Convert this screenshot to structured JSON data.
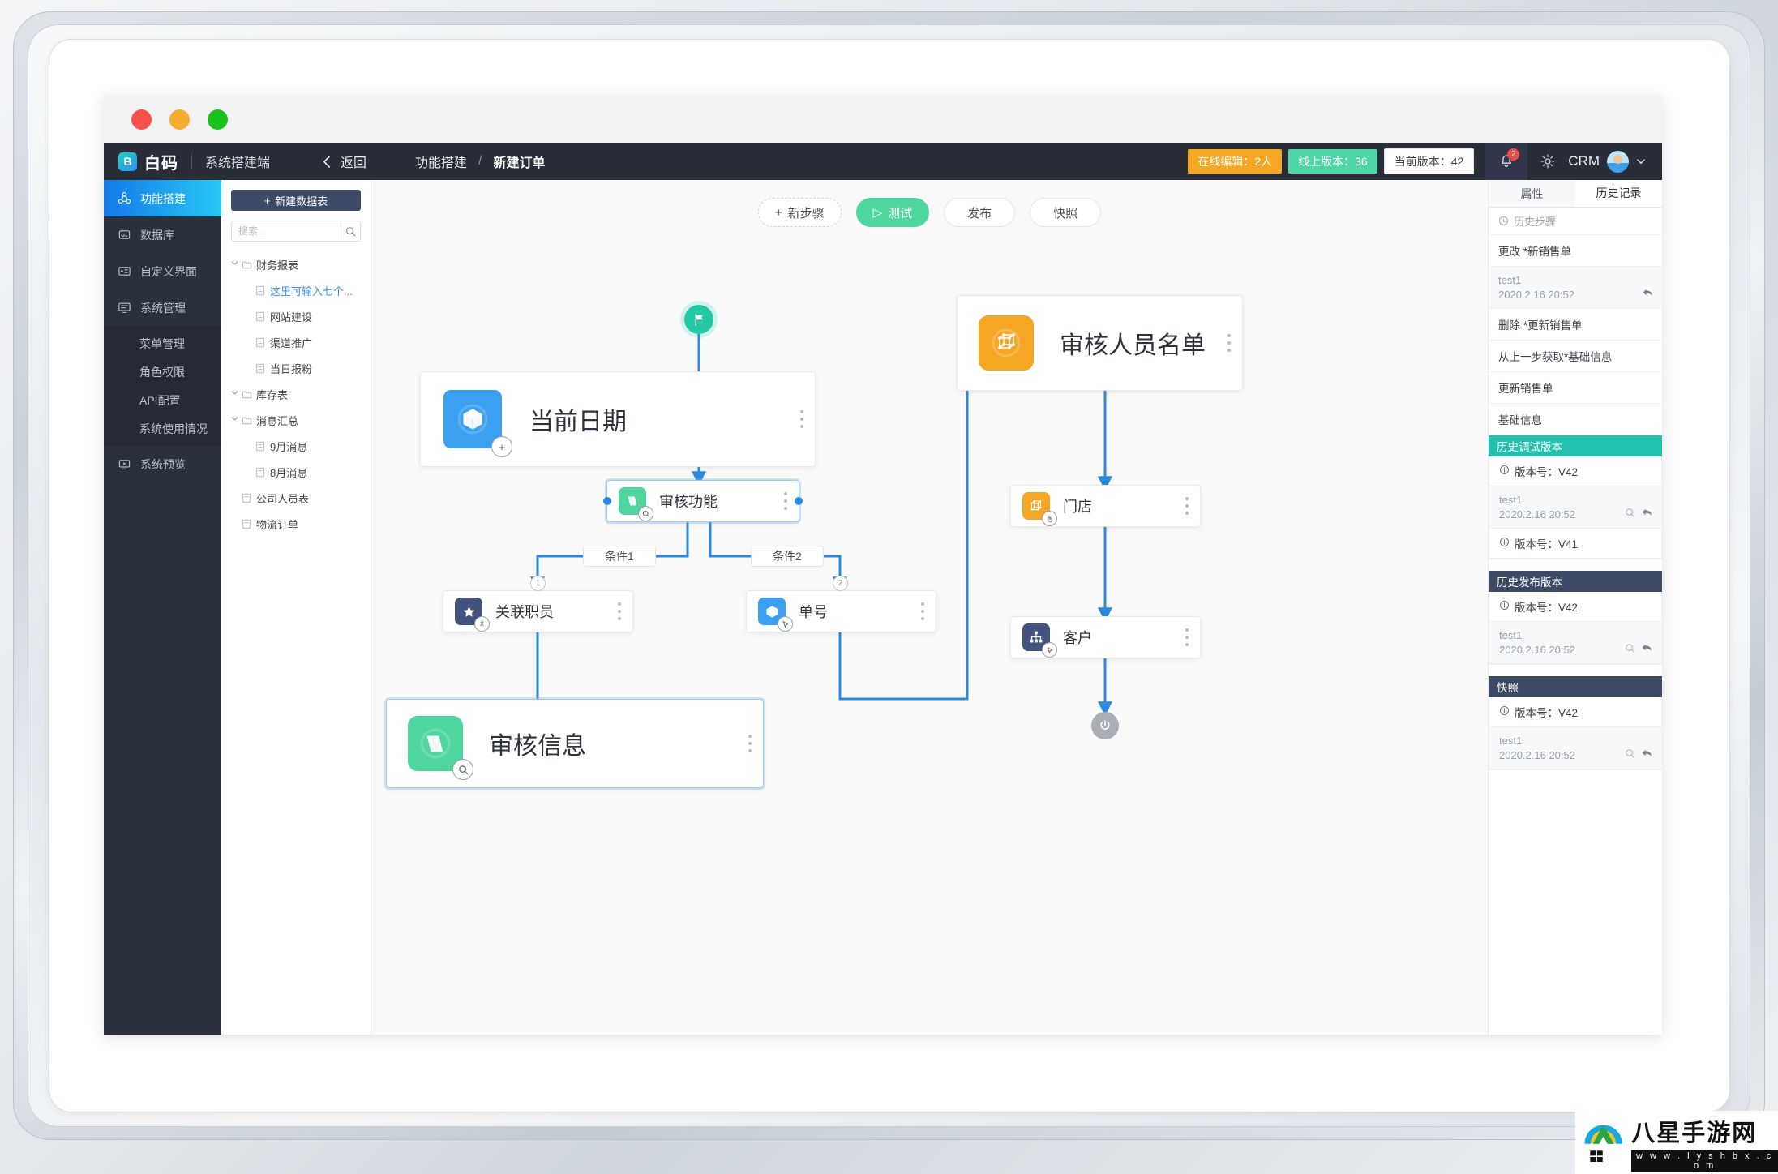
{
  "window_controls": [
    "close",
    "minimize",
    "maximize"
  ],
  "header": {
    "logo_text": "白码",
    "logo_mark": "B",
    "subtitle": "系统搭建端",
    "back_label": "返回",
    "back_icon": "chevron-left-icon",
    "breadcrumb": {
      "parent": "功能搭建",
      "separator": "/",
      "current": "新建订单"
    },
    "badges": [
      {
        "label": "在线编辑：2人",
        "style": "orange"
      },
      {
        "label": "线上版本：36",
        "style": "green"
      },
      {
        "label": "当前版本：42",
        "style": "white"
      }
    ],
    "bell_icon": "bell-icon",
    "bell_count": "2",
    "gear_icon": "gear-icon",
    "user_name": "CRM",
    "caret_icon": "chevron-down-icon"
  },
  "sidebar": {
    "items": [
      {
        "label": "功能搭建",
        "icon": "build-icon",
        "active": true
      },
      {
        "label": "数据库",
        "icon": "database-icon",
        "active": false
      },
      {
        "label": "自定义界面",
        "icon": "layout-icon",
        "active": false
      },
      {
        "label": "系统管理",
        "icon": "monitor-icon",
        "active": false
      }
    ],
    "sub_items": [
      "菜单管理",
      "角色权限",
      "API配置",
      "系统使用情况"
    ],
    "last_item": {
      "label": "系统预览",
      "icon": "preview-icon"
    }
  },
  "tree_panel": {
    "new_table_label": "新建数据表",
    "new_table_icon": "plus-icon",
    "search_placeholder": "搜索...",
    "search_value": "",
    "search_icon": "search-icon",
    "nodes": [
      {
        "label": "财务报表",
        "level": 1,
        "type": "folder",
        "expanded": true,
        "selected": false
      },
      {
        "label": "这里可输入七个...",
        "level": 2,
        "type": "table",
        "selected": true
      },
      {
        "label": "网站建设",
        "level": 2,
        "type": "table",
        "selected": false
      },
      {
        "label": "渠道推广",
        "level": 2,
        "type": "table",
        "selected": false
      },
      {
        "label": "当日报粉",
        "level": 2,
        "type": "table",
        "selected": false
      },
      {
        "label": "库存表",
        "level": 1,
        "type": "folder",
        "expanded": true,
        "selected": false
      },
      {
        "label": "消息汇总",
        "level": 1,
        "type": "folder",
        "expanded": true,
        "selected": false
      },
      {
        "label": "9月消息",
        "level": 2,
        "type": "table",
        "selected": false
      },
      {
        "label": "8月消息",
        "level": 2,
        "type": "table",
        "selected": false
      },
      {
        "label": "公司人员表",
        "level": 1,
        "type": "table",
        "selected": false
      },
      {
        "label": "物流订单",
        "level": 1,
        "type": "table",
        "selected": false
      }
    ]
  },
  "canvas": {
    "toolbar": [
      {
        "label": "新步骤",
        "icon": "plus-icon",
        "style": "dashed"
      },
      {
        "label": "测试",
        "icon": "play-icon",
        "style": "primary"
      },
      {
        "label": "发布",
        "icon": "",
        "style": "normal"
      },
      {
        "label": "快照",
        "icon": "",
        "style": "normal"
      }
    ],
    "start_icon": "flag-icon",
    "end_icon": "power-icon",
    "nodes": [
      {
        "id": "n1",
        "title": "当前日期",
        "icon": "cube-icon",
        "icon_color": "#3ba0ef",
        "badge": "+",
        "size": "large",
        "selected": false
      },
      {
        "id": "n2",
        "title": "审核功能",
        "icon": "layers-icon",
        "icon_color": "#4fd69f",
        "badge": "search",
        "size": "small",
        "selected": true
      },
      {
        "id": "n3",
        "title": "关联职员",
        "icon": "star-icon",
        "icon_color": "#43527f",
        "badge": "x",
        "size": "small",
        "selected": false
      },
      {
        "id": "n4",
        "title": "单号",
        "icon": "cube-icon",
        "icon_color": "#3ba0ef",
        "badge": "cursor",
        "size": "small",
        "selected": false
      },
      {
        "id": "n5",
        "title": "审核信息",
        "icon": "layers-icon",
        "icon_color": "#4fd69f",
        "badge": "search",
        "size": "large",
        "selected": true
      },
      {
        "id": "n6",
        "title": "审核人员名单",
        "icon": "graph-icon",
        "icon_color": "#f5a623",
        "badge": "",
        "size": "large",
        "selected": false
      },
      {
        "id": "n7",
        "title": "门店",
        "icon": "graph-icon",
        "icon_color": "#f5a623",
        "badge": "hand",
        "size": "small",
        "selected": false
      },
      {
        "id": "n8",
        "title": "客户",
        "icon": "org-icon",
        "icon_color": "#43527f",
        "badge": "cursor",
        "size": "small",
        "selected": false
      }
    ],
    "condition_labels": [
      "条件1",
      "条件2"
    ],
    "branch_numbers": [
      "1",
      "2"
    ]
  },
  "right_panel": {
    "tabs": [
      {
        "label": "属性",
        "active": false
      },
      {
        "label": "历史记录",
        "active": true
      }
    ],
    "history_header": {
      "label": "历史步骤",
      "icon": "clock-icon"
    },
    "history_rows": [
      {
        "type": "title",
        "label": "更改 *新销售单"
      },
      {
        "type": "meta",
        "user": "test1",
        "datetime": "2020.2.16   20:52",
        "revert_icon": "revert-icon"
      },
      {
        "type": "title",
        "label": "删除 *更新销售单"
      },
      {
        "type": "title",
        "label": "从上一步获取*基础信息"
      },
      {
        "type": "title",
        "label": "更新销售单"
      },
      {
        "type": "title",
        "label": "基础信息"
      }
    ],
    "sections": [
      {
        "title": "历史调试版本",
        "style": "teal",
        "rows": [
          {
            "type": "version",
            "label": "版本号：V42",
            "icon": "info-icon"
          },
          {
            "type": "meta",
            "user": "test1",
            "datetime": "2020.2.16   20:52",
            "view_icon": "search-icon",
            "revert_icon": "revert-icon"
          },
          {
            "type": "version",
            "label": "版本号：V41",
            "icon": "info-icon"
          }
        ]
      },
      {
        "title": "历史发布版本",
        "style": "navy",
        "rows": [
          {
            "type": "version",
            "label": "版本号：V42",
            "icon": "info-icon"
          },
          {
            "type": "meta",
            "user": "test1",
            "datetime": "2020.2.16   20:52",
            "view_icon": "search-icon",
            "revert_icon": "revert-icon"
          }
        ]
      },
      {
        "title": "快照",
        "style": "navy",
        "rows": [
          {
            "type": "version",
            "label": "版本号：V42",
            "icon": "info-icon"
          },
          {
            "type": "meta",
            "user": "test1",
            "datetime": "2020.2.16   20:52",
            "view_icon": "search-icon",
            "revert_icon": "revert-icon"
          }
        ]
      }
    ]
  },
  "watermark": {
    "name": "八星手游网",
    "url": "w w w . l y s h b x . c o m"
  },
  "colors": {
    "header_bg": "#282d38",
    "nav_bg": "#2b303d",
    "accent_blue": "#2b8ae0",
    "accent_green": "#4fd69f",
    "accent_teal": "#23c1b0",
    "accent_orange": "#f5a623",
    "navy": "#3d4a66"
  }
}
